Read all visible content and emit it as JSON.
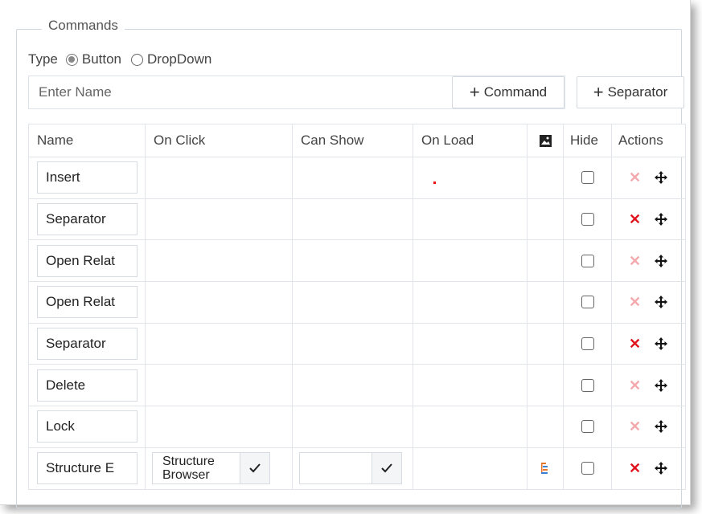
{
  "commands": {
    "legend": "Commands",
    "type_label": "Type",
    "type_options": [
      "Button",
      "DropDown"
    ],
    "type_selected": "Button",
    "name_placeholder": "Enter Name",
    "add_command_label": "Command",
    "add_separator_label": "Separator"
  },
  "table": {
    "headers": {
      "name": "Name",
      "on_click": "On Click",
      "can_show": "Can Show",
      "on_load": "On Load",
      "image_icon": "image-icon",
      "hide": "Hide",
      "actions": "Actions"
    },
    "rows": [
      {
        "name": "Insert",
        "delete_state": "disabled"
      },
      {
        "name": "Separator",
        "delete_state": "enabled"
      },
      {
        "name": "Open Relat",
        "delete_state": "disabled"
      },
      {
        "name": "Open Relat",
        "delete_state": "disabled"
      },
      {
        "name": "Separator",
        "delete_state": "enabled"
      },
      {
        "name": "Delete",
        "delete_state": "disabled"
      },
      {
        "name": "Lock",
        "delete_state": "disabled"
      },
      {
        "name": "Structure E",
        "delete_state": "enabled",
        "on_click": "Structure Browser",
        "can_show": ""
      }
    ]
  },
  "colors": {
    "delete_enabled": "#e0141e",
    "delete_disabled": "#f4a9ad",
    "border": "#e1e5ea"
  }
}
